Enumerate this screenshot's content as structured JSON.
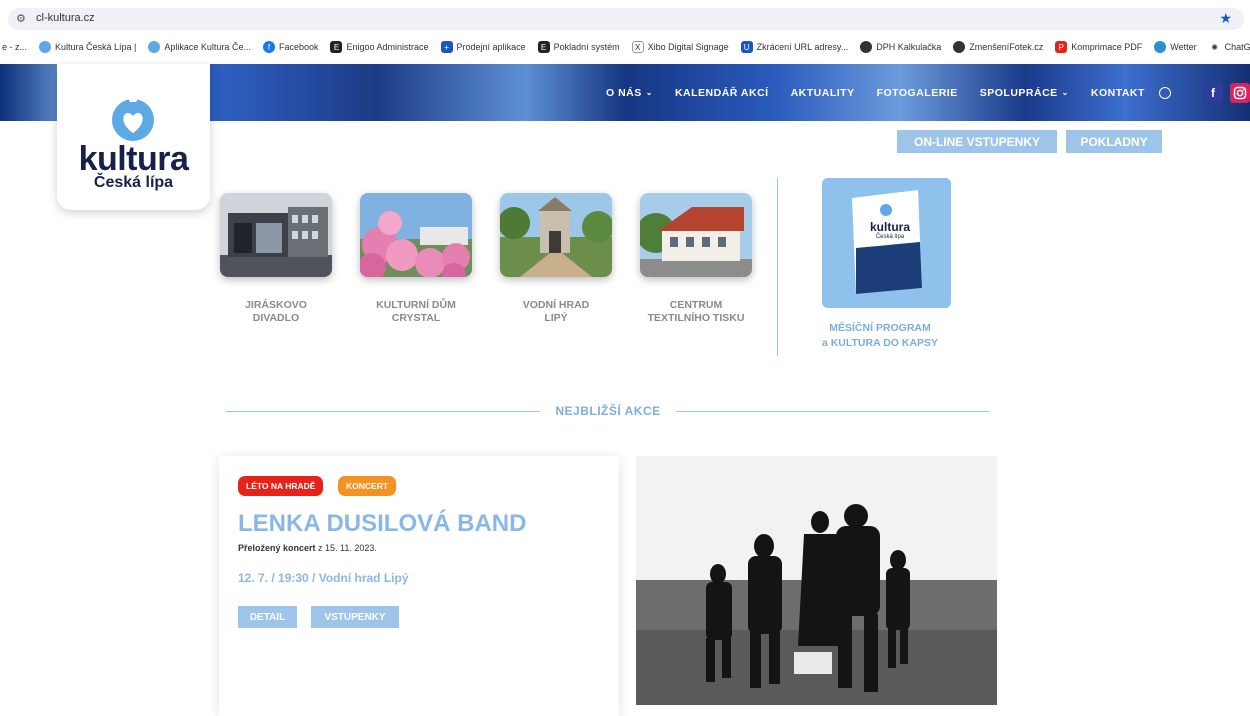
{
  "browser": {
    "url": "cl-kultura.cz",
    "bookmarks": [
      {
        "label": "e - z..."
      },
      {
        "label": "Kultura Česká Lípa |"
      },
      {
        "label": "Aplikace Kultura Če..."
      },
      {
        "label": "Facebook"
      },
      {
        "label": "Enigoo Administrace"
      },
      {
        "label": "Prodejní aplikace"
      },
      {
        "label": "Pokladní systém"
      },
      {
        "label": "Xibo Digital Signage"
      },
      {
        "label": "Zkrácení URL adresy..."
      },
      {
        "label": "DPH Kalkulačka"
      },
      {
        "label": "ZmenšeníFotek.cz"
      },
      {
        "label": "Komprimace PDF"
      },
      {
        "label": "Wetter"
      },
      {
        "label": "ChatGPT"
      }
    ]
  },
  "logo": {
    "name": "kultura",
    "sub": "Česká lípa"
  },
  "nav": {
    "items": [
      "O NÁS",
      "KALENDÁŘ AKCÍ",
      "AKTUALITY",
      "FOTOGALERIE",
      "SPOLUPRÁCE",
      "KONTAKT"
    ],
    "facebook": "f",
    "colors": {
      "facebook": "#2b3e9b",
      "instagram": "#d8245e"
    }
  },
  "top_buttons": {
    "online": "ON-LINE VSTUPENKY",
    "pokladny": "POKLADNY"
  },
  "venues": [
    {
      "line1": "JIRÁSKOVO",
      "line2": "DIVADLO"
    },
    {
      "line1": "KULTURNÍ DŮM",
      "line2": "CRYSTAL"
    },
    {
      "line1": "VODNÍ HRAD",
      "line2": "LIPÝ"
    },
    {
      "line1": "CENTRUM",
      "line2": "TEXTILNÍHO TISKU"
    }
  ],
  "program": {
    "line1": "MĚSÍČNÍ PROGRAM",
    "line2": "a KULTURA DO KAPSY",
    "book_title": "kultura",
    "book_sub": "Česká lípa"
  },
  "section": {
    "title": "NEJBLIŽŠÍ AKCE"
  },
  "event": {
    "tags": [
      "LÉTO NA HRADĚ",
      "KONCERT"
    ],
    "title": "LENKA DUSILOVÁ BAND",
    "note_bold": "Přeložený koncert",
    "note_rest": " z 15. 11. 2023.",
    "date": "12. 7. / 19:30 / Vodní hrad Lipý",
    "detail": "DETAIL",
    "tickets": "VSTUPENKY"
  },
  "colors": {
    "accent": "#9ec4ea",
    "title_blue": "#8ab8e6",
    "tag_red": "#e8221b",
    "tag_orange": "#f29322"
  }
}
